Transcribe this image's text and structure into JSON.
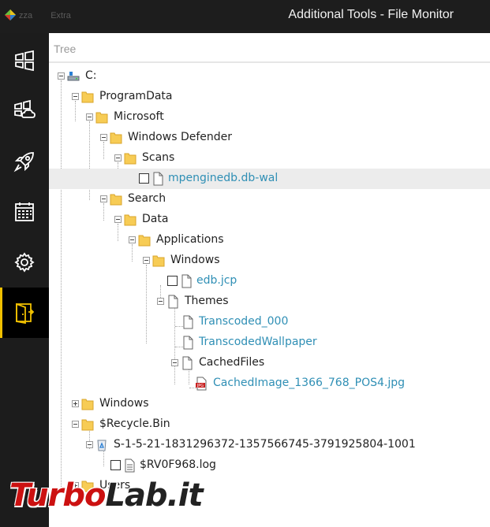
{
  "window": {
    "title": "Additional Tools - File Monitor",
    "menu_faded": [
      "zza",
      "Extra"
    ]
  },
  "sidebar": {
    "items": [
      {
        "icon": "windows-tiles-icon",
        "active": false
      },
      {
        "icon": "cloud-tiles-icon",
        "active": false
      },
      {
        "icon": "rocket-icon",
        "active": false
      },
      {
        "icon": "calendar-icon",
        "active": false
      },
      {
        "icon": "gear-icon",
        "active": false
      },
      {
        "icon": "tools-door-icon",
        "active": true
      }
    ],
    "accent_color": "#f0c000"
  },
  "panel": {
    "header": "Tree"
  },
  "tree": [
    {
      "label": "C:",
      "type": "drive"
    },
    {
      "label": "ProgramData",
      "type": "folder"
    },
    {
      "label": "Microsoft",
      "type": "folder"
    },
    {
      "label": "Windows Defender",
      "type": "folder"
    },
    {
      "label": "Scans",
      "type": "folder"
    },
    {
      "label": "mpenginedb.db-wal",
      "type": "file",
      "selected": true
    },
    {
      "label": "Search",
      "type": "folder"
    },
    {
      "label": "Data",
      "type": "folder"
    },
    {
      "label": "Applications",
      "type": "folder"
    },
    {
      "label": "Windows",
      "type": "folder"
    },
    {
      "label": "edb.jcp",
      "type": "file"
    },
    {
      "label": "Themes",
      "type": "doc"
    },
    {
      "label": "Transcoded_000",
      "type": "file"
    },
    {
      "label": "TranscodedWallpaper",
      "type": "file"
    },
    {
      "label": "CachedFiles",
      "type": "doc"
    },
    {
      "label": "CachedImage_1366_768_POS4.jpg",
      "type": "jpg"
    },
    {
      "label": "Windows",
      "type": "folder"
    },
    {
      "label": "$Recycle.Bin",
      "type": "folder"
    },
    {
      "label": "S-1-5-21-1831296372-1357566745-3791925804-1001",
      "type": "recycle"
    },
    {
      "label": "$RV0F968.log",
      "type": "log"
    },
    {
      "label": "Users",
      "type": "folder"
    }
  ],
  "watermark": {
    "part1": "Turbo",
    "part2": "Lab.it"
  },
  "colors": {
    "file_text": "#2f8fb5",
    "folder": "#f7cc55",
    "sidebar_bg": "#1c1c1c"
  }
}
